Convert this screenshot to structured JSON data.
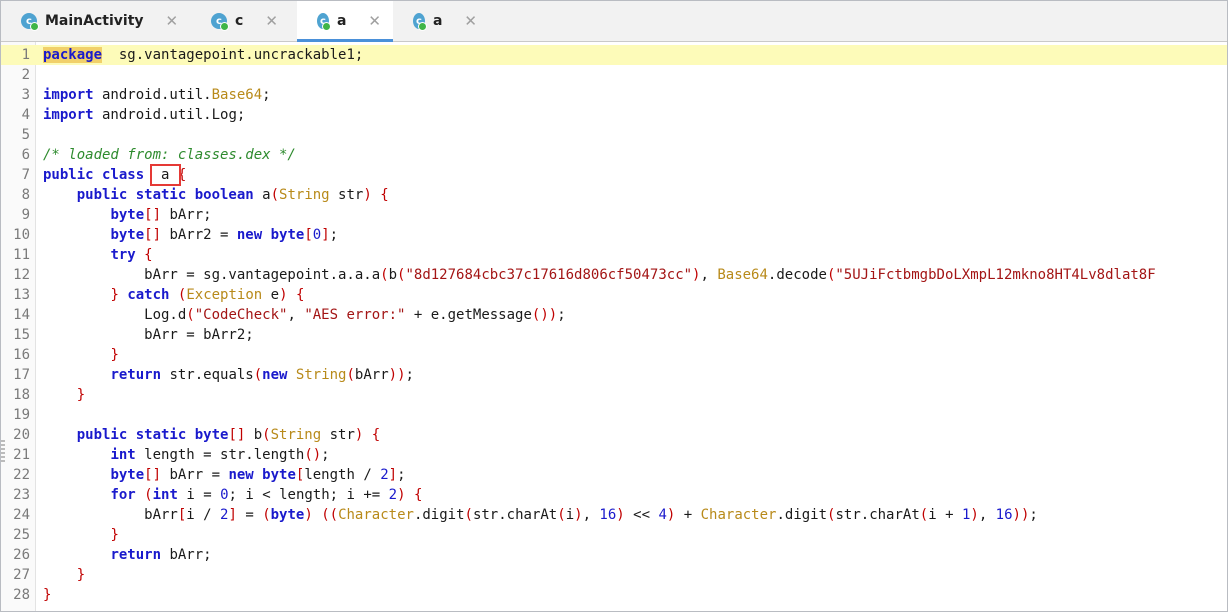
{
  "tabs": [
    {
      "icon": "c",
      "label": "MainActivity",
      "active": false
    },
    {
      "icon": "c",
      "label": "c",
      "active": false
    },
    {
      "icon": "c",
      "label": "a",
      "active": true
    },
    {
      "icon": "c",
      "label": "a",
      "active": false
    }
  ],
  "close_glyph": "✕",
  "colors": {
    "keyword": "#1a1acc",
    "class_name": "#b88a1a",
    "string": "#a31515",
    "paren": "#c00000",
    "comment": "#2e8b2e",
    "current_line": "#fdfbb9",
    "selection_box": "#e53935",
    "tab_underline": "#4a90d9"
  },
  "lines": [
    {
      "n": "1",
      "hl": true,
      "tokens": [
        [
          "kw-hl",
          "package"
        ],
        [
          "",
          "  sg.vantagepoint.uncrackable1;"
        ]
      ]
    },
    {
      "n": "2",
      "tokens": []
    },
    {
      "n": "3",
      "tokens": [
        [
          "kw",
          "import"
        ],
        [
          "",
          " android.util."
        ],
        [
          "cls",
          "Base64"
        ],
        [
          "",
          ";"
        ]
      ]
    },
    {
      "n": "4",
      "tokens": [
        [
          "kw",
          "import"
        ],
        [
          "",
          " android.util.Log;"
        ]
      ]
    },
    {
      "n": "5",
      "tokens": []
    },
    {
      "n": "6",
      "tokens": [
        [
          "cm",
          "/* loaded from: classes.dex */"
        ]
      ]
    },
    {
      "n": "7",
      "tokens": [
        [
          "kw",
          "public class"
        ],
        [
          "",
          " "
        ],
        [
          "boxed",
          " a "
        ],
        [
          "p",
          "{"
        ]
      ]
    },
    {
      "n": "8",
      "tokens": [
        [
          "",
          "    "
        ],
        [
          "kw",
          "public static boolean"
        ],
        [
          "",
          " a"
        ],
        [
          "p",
          "("
        ],
        [
          "cls",
          "String"
        ],
        [
          "",
          " str"
        ],
        [
          "p",
          ")"
        ],
        [
          "",
          " "
        ],
        [
          "p",
          "{"
        ]
      ]
    },
    {
      "n": "9",
      "tokens": [
        [
          "",
          "        "
        ],
        [
          "kw",
          "byte"
        ],
        [
          "p",
          "[]"
        ],
        [
          "",
          " bArr;"
        ]
      ]
    },
    {
      "n": "10",
      "tokens": [
        [
          "",
          "        "
        ],
        [
          "kw",
          "byte"
        ],
        [
          "p",
          "[]"
        ],
        [
          "",
          " bArr2 = "
        ],
        [
          "kw",
          "new byte"
        ],
        [
          "p",
          "["
        ],
        [
          "num",
          "0"
        ],
        [
          "p",
          "]"
        ],
        [
          "",
          ";"
        ]
      ]
    },
    {
      "n": "11",
      "tokens": [
        [
          "",
          "        "
        ],
        [
          "kw",
          "try"
        ],
        [
          "",
          " "
        ],
        [
          "p",
          "{"
        ]
      ]
    },
    {
      "n": "12",
      "tokens": [
        [
          "",
          "            bArr = sg.vantagepoint.a.a.a"
        ],
        [
          "p",
          "("
        ],
        [
          "",
          "b"
        ],
        [
          "p",
          "("
        ],
        [
          "str",
          "\"8d127684cbc37c17616d806cf50473cc\""
        ],
        [
          "p",
          ")"
        ],
        [
          "",
          ", "
        ],
        [
          "cls",
          "Base64"
        ],
        [
          "",
          ".decode"
        ],
        [
          "p",
          "("
        ],
        [
          "str",
          "\"5UJiFctbmgbDoLXmpL12mkno8HT4Lv8dlat8F"
        ]
      ]
    },
    {
      "n": "13",
      "tokens": [
        [
          "",
          "        "
        ],
        [
          "p",
          "}"
        ],
        [
          "",
          " "
        ],
        [
          "kw",
          "catch"
        ],
        [
          "",
          " "
        ],
        [
          "p",
          "("
        ],
        [
          "cls",
          "Exception"
        ],
        [
          "",
          " e"
        ],
        [
          "p",
          ")"
        ],
        [
          "",
          " "
        ],
        [
          "p",
          "{"
        ]
      ]
    },
    {
      "n": "14",
      "tokens": [
        [
          "",
          "            Log.d"
        ],
        [
          "p",
          "("
        ],
        [
          "str",
          "\"CodeCheck\""
        ],
        [
          "",
          ", "
        ],
        [
          "str",
          "\"AES error:\""
        ],
        [
          "",
          " + e.getMessage"
        ],
        [
          "p",
          "()"
        ],
        [
          "p",
          ")"
        ],
        [
          "",
          ";"
        ]
      ]
    },
    {
      "n": "15",
      "tokens": [
        [
          "",
          "            bArr = bArr2;"
        ]
      ]
    },
    {
      "n": "16",
      "tokens": [
        [
          "",
          "        "
        ],
        [
          "p",
          "}"
        ]
      ]
    },
    {
      "n": "17",
      "tokens": [
        [
          "",
          "        "
        ],
        [
          "kw",
          "return"
        ],
        [
          "",
          " str.equals"
        ],
        [
          "p",
          "("
        ],
        [
          "kw",
          "new"
        ],
        [
          "",
          " "
        ],
        [
          "cls",
          "String"
        ],
        [
          "p",
          "("
        ],
        [
          "",
          "bArr"
        ],
        [
          "p",
          "))"
        ],
        [
          "",
          ";"
        ]
      ]
    },
    {
      "n": "18",
      "tokens": [
        [
          "",
          "    "
        ],
        [
          "p",
          "}"
        ]
      ]
    },
    {
      "n": "19",
      "tokens": []
    },
    {
      "n": "20",
      "tokens": [
        [
          "",
          "    "
        ],
        [
          "kw",
          "public static byte"
        ],
        [
          "p",
          "[]"
        ],
        [
          "",
          " b"
        ],
        [
          "p",
          "("
        ],
        [
          "cls",
          "String"
        ],
        [
          "",
          " str"
        ],
        [
          "p",
          ")"
        ],
        [
          "",
          " "
        ],
        [
          "p",
          "{"
        ]
      ]
    },
    {
      "n": "21",
      "tokens": [
        [
          "",
          "        "
        ],
        [
          "kw",
          "int"
        ],
        [
          "",
          " length = str.length"
        ],
        [
          "p",
          "()"
        ],
        [
          "",
          ";"
        ]
      ]
    },
    {
      "n": "22",
      "tokens": [
        [
          "",
          "        "
        ],
        [
          "kw",
          "byte"
        ],
        [
          "p",
          "[]"
        ],
        [
          "",
          " bArr = "
        ],
        [
          "kw",
          "new byte"
        ],
        [
          "p",
          "["
        ],
        [
          "",
          "length / "
        ],
        [
          "num",
          "2"
        ],
        [
          "p",
          "]"
        ],
        [
          "",
          ";"
        ]
      ]
    },
    {
      "n": "23",
      "tokens": [
        [
          "",
          "        "
        ],
        [
          "kw",
          "for"
        ],
        [
          "",
          " "
        ],
        [
          "p",
          "("
        ],
        [
          "kw",
          "int"
        ],
        [
          "",
          " i = "
        ],
        [
          "num",
          "0"
        ],
        [
          "",
          ";"
        ],
        [
          "",
          " i < length; i += "
        ],
        [
          "num",
          "2"
        ],
        [
          "p",
          ")"
        ],
        [
          "",
          " "
        ],
        [
          "p",
          "{"
        ]
      ]
    },
    {
      "n": "24",
      "tokens": [
        [
          "",
          "            bArr"
        ],
        [
          "p",
          "["
        ],
        [
          "",
          "i / "
        ],
        [
          "num",
          "2"
        ],
        [
          "p",
          "]"
        ],
        [
          "",
          " = "
        ],
        [
          "p",
          "("
        ],
        [
          "kw",
          "byte"
        ],
        [
          "p",
          ")"
        ],
        [
          "",
          " "
        ],
        [
          "p",
          "(("
        ],
        [
          "cls",
          "Character"
        ],
        [
          "",
          ".digit"
        ],
        [
          "p",
          "("
        ],
        [
          "",
          "str.charAt"
        ],
        [
          "p",
          "("
        ],
        [
          "",
          "i"
        ],
        [
          "p",
          ")"
        ],
        [
          "",
          ", "
        ],
        [
          "num",
          "16"
        ],
        [
          "p",
          ")"
        ],
        [
          "",
          " << "
        ],
        [
          "num",
          "4"
        ],
        [
          "p",
          ")"
        ],
        [
          "",
          " + "
        ],
        [
          "cls",
          "Character"
        ],
        [
          "",
          ".digit"
        ],
        [
          "p",
          "("
        ],
        [
          "",
          "str.charAt"
        ],
        [
          "p",
          "("
        ],
        [
          "",
          "i + "
        ],
        [
          "num",
          "1"
        ],
        [
          "p",
          ")"
        ],
        [
          "",
          ", "
        ],
        [
          "num",
          "16"
        ],
        [
          "p",
          "))"
        ],
        [
          "",
          ";"
        ]
      ]
    },
    {
      "n": "25",
      "tokens": [
        [
          "",
          "        "
        ],
        [
          "p",
          "}"
        ]
      ]
    },
    {
      "n": "26",
      "tokens": [
        [
          "",
          "        "
        ],
        [
          "kw",
          "return"
        ],
        [
          "",
          " bArr;"
        ]
      ]
    },
    {
      "n": "27",
      "tokens": [
        [
          "",
          "    "
        ],
        [
          "p",
          "}"
        ]
      ]
    },
    {
      "n": "28",
      "tokens": [
        [
          "p",
          "}"
        ]
      ]
    }
  ]
}
